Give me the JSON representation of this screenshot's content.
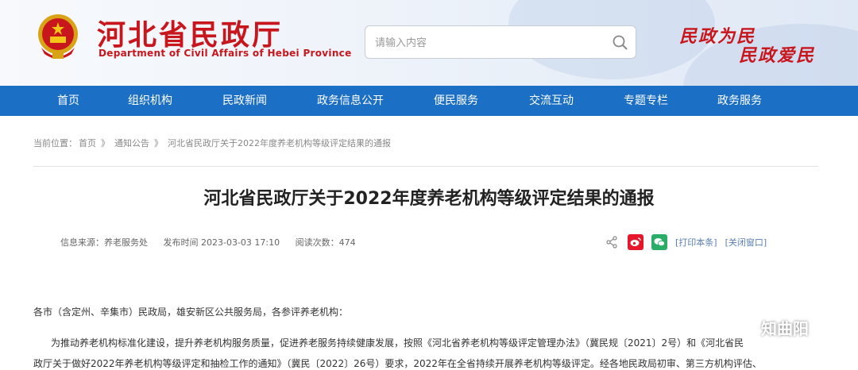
{
  "header": {
    "title": "河北省民政厅",
    "subtitle": "Department of Civil Affairs of Hebei Province",
    "search_placeholder": "请输入内容",
    "slogan_line1": "民政为民",
    "slogan_line2": "民政爱民"
  },
  "nav": {
    "items": [
      "首页",
      "组织机构",
      "民政新闻",
      "政务信息公开",
      "便民服务",
      "交流互动",
      "专题专栏",
      "政务服务"
    ]
  },
  "breadcrumb": {
    "prefix": "当前位置：",
    "home": "首页",
    "sep": "》",
    "section": "通知公告",
    "current": "河北省民政厅关于2022年度养老机构等级评定结果的通报"
  },
  "article": {
    "title": "河北省民政厅关于2022年度养老机构等级评定结果的通报",
    "source": "信息来源：养老服务处",
    "publish_time": "发布时间 2023-03-03 17:10",
    "views": "阅读次数：474",
    "print_label": "[打印本条]",
    "close_label": "[关闭窗口]",
    "para1": "各市（含定州、辛集市）民政局，雄安新区公共服务局，各参评养老机构：",
    "para2": "为推动养老机构标准化建设，提升养老机构服务质量，促进养老服务持续健康发展，按照《河北省养老机构等级评定管理办法》（冀民规〔2021〕2号）和《河北省民",
    "para3": "政厅关于做好2022年养老机构等级评定和抽检工作的通知》（冀民〔2022〕26号）要求，2022年在全省持续开展养老机构等级评定。经各地民政局初审、第三方机构评估、"
  },
  "watermark": {
    "text": "知曲阳"
  },
  "colors": {
    "brand_red": "#c8161d",
    "nav_blue": "#1b6fc4",
    "weibo": "#e6162d",
    "wechat": "#2aae67"
  },
  "icons": [
    "emblem-icon",
    "search-icon",
    "share-icon",
    "weibo-icon",
    "wechat-icon",
    "watermark-wechat-icon"
  ]
}
